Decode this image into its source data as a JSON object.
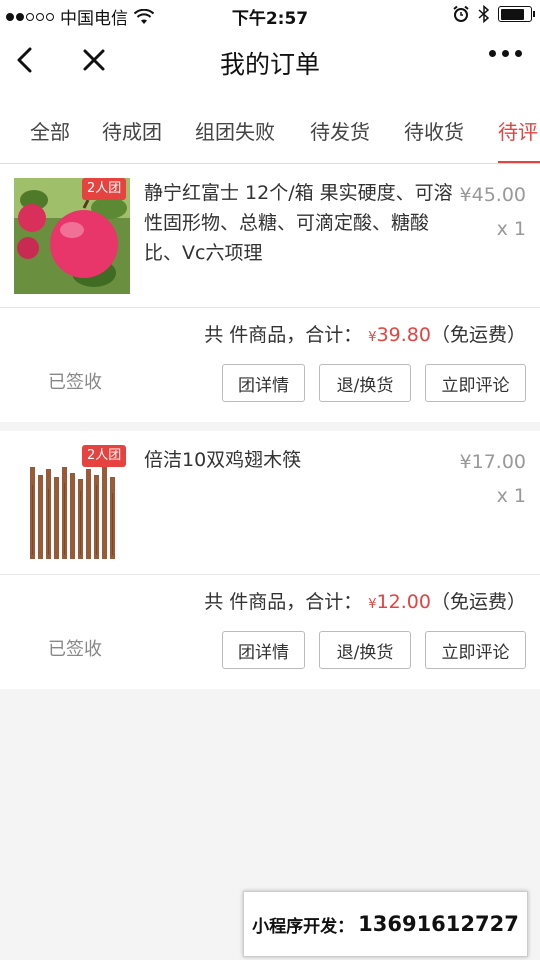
{
  "statusbar": {
    "carrier": "中国电信",
    "time": "下午2:57"
  },
  "nav": {
    "title": "我的订单"
  },
  "tabs": [
    {
      "label": "全部"
    },
    {
      "label": "待成团"
    },
    {
      "label": "组团失败"
    },
    {
      "label": "待发货"
    },
    {
      "label": "待收货"
    },
    {
      "label": "待评"
    }
  ],
  "active_tab_index": 5,
  "colors": {
    "accent": "#e64340",
    "muted": "#999999"
  },
  "orders": [
    {
      "badge": "2人团",
      "name": "静宁红富士 12个/箱 果实硬度、可溶性固形物、总糖、可滴定酸、糖酸比、Vc六项理",
      "price": "¥45.00",
      "qty": "x 1",
      "total_prefix": "共 件商品，合计：",
      "total_currency": "¥",
      "total_amount": "39.80",
      "shipping": "（免运费）",
      "status": "已签收",
      "buttons": [
        "团详情",
        "退/换货",
        "立即评论"
      ]
    },
    {
      "badge": "2人团",
      "name": "倍洁10双鸡翅木筷",
      "price": "¥17.00",
      "qty": "x 1",
      "total_prefix": "共 件商品，合计：",
      "total_currency": "¥",
      "total_amount": "12.00",
      "shipping": "（免运费）",
      "status": "已签收",
      "buttons": [
        "团详情",
        "退/换货",
        "立即评论"
      ]
    }
  ],
  "ad": {
    "label": "小程序开发：",
    "phone": "13691612727"
  }
}
